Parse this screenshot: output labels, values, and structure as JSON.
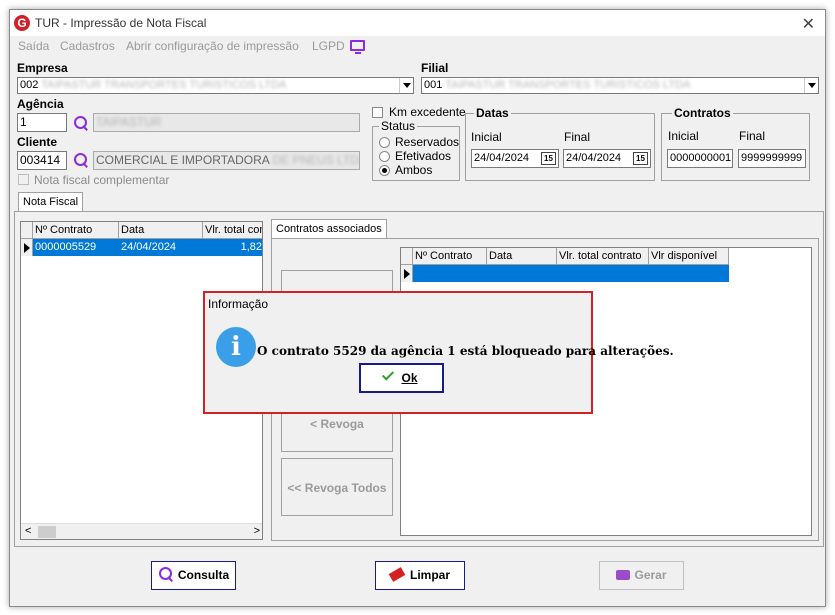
{
  "window": {
    "title": "TUR - Impressão de Nota Fiscal",
    "logo": "G"
  },
  "menu": {
    "items": [
      "Saída",
      "Cadastros",
      "Abrir configuração de impressão",
      "LGPD"
    ]
  },
  "empresa": {
    "label": "Empresa",
    "code": "002",
    "name": "TAIPASTUR TRANSPORTES TURISTICOS LTDA"
  },
  "filial": {
    "label": "Filial",
    "code": "001",
    "name": "TAIPASTUR TRANSPORTES TURISTICOS LTDA"
  },
  "agencia": {
    "label": "Agência",
    "value": "1",
    "name": "TAIPASTUR"
  },
  "cliente": {
    "label": "Cliente",
    "value": "003414",
    "name_visible": "COMERCIAL E IMPORTADORA",
    "name_blur": "DE PNEUS LTDA"
  },
  "nf_complementar": {
    "label": "Nota fiscal complementar"
  },
  "km_excedente": {
    "label": "Km excedente"
  },
  "status": {
    "title": "Status",
    "options": [
      "Reservados",
      "Efetivados",
      "Ambos"
    ],
    "selected": "Ambos"
  },
  "datas": {
    "title": "Datas",
    "inicial_label": "Inicial",
    "final_label": "Final",
    "inicial": "24/04/2024",
    "final": "24/04/2024",
    "cal_icon": "15"
  },
  "contratos": {
    "title": "Contratos",
    "inicial_label": "Inicial",
    "final_label": "Final",
    "inicial": "0000000001",
    "final": "9999999999"
  },
  "tabs": {
    "main": "Nota Fiscal",
    "sub": "Contratos associados"
  },
  "left_grid": {
    "columns": [
      "Nº Contrato",
      "Data",
      "Vlr. total con"
    ],
    "rows": [
      {
        "contrato": "0000005529",
        "data": "24/04/2024",
        "valor": "1,82"
      }
    ]
  },
  "right_grid": {
    "columns": [
      "Nº Contrato",
      "Data",
      "Vlr. total contrato",
      "Vlr disponível"
    ]
  },
  "side_buttons": {
    "revoga": "< Revoga",
    "revoga_todos": "<< Revoga Todos"
  },
  "footer": {
    "consulta": "Consulta",
    "limpar": "Limpar",
    "gerar": "Gerar"
  },
  "dialog": {
    "title": "Informação",
    "message": "O contrato 5529 da agência 1 está bloqueado para alterações.",
    "ok": "Ok",
    "info_icon": "i"
  }
}
